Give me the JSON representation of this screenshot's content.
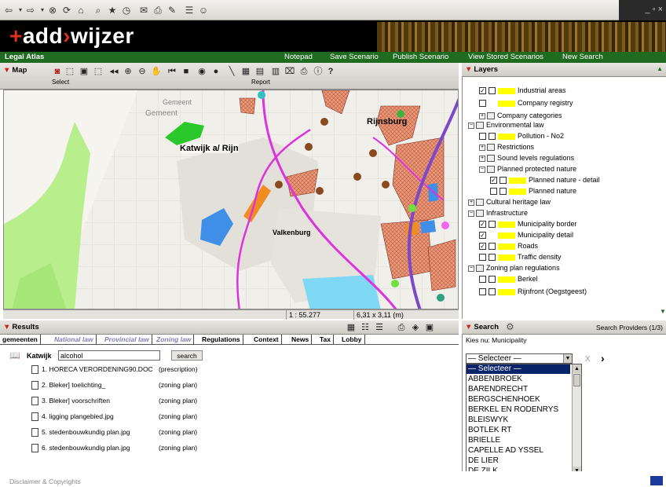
{
  "browser": {
    "toolbar_icons": [
      "back-icon",
      "forward-icon",
      "stop-icon",
      "refresh-icon",
      "home-icon",
      "search-icon",
      "favorites-icon",
      "history-icon",
      "mail-icon",
      "print-icon",
      "edit-icon",
      "discuss-icon",
      "messenger-icon"
    ],
    "window_controls": "_ ▫ ×"
  },
  "banner": {
    "logo_plus": "+",
    "logo_add": "add",
    "logo_arrow": "›",
    "logo_wijzer": "wijzer"
  },
  "greenbar": {
    "title": "Legal Atlas",
    "nav": [
      "Notepad",
      "Save Scenario",
      "Publish Scenario",
      "View Stored Scenarios",
      "New Search"
    ]
  },
  "map_panel": {
    "label": "Map",
    "select_label": "Select",
    "report_label": "Report",
    "help": "?",
    "scale": "1 : 55.277",
    "extent": "6,31 x 3,11 (m)",
    "places": {
      "katwijk": "Katwijk a/ Rijn",
      "rijnsburg": "Rijnsburg",
      "valkenburg": "Valkenburg",
      "gemeente": "Gemeent",
      "gemeente2": "Gemeent"
    }
  },
  "layers": {
    "label": "Layers",
    "rows": [
      {
        "label": "Industrial areas",
        "checked": true,
        "swatch": true
      },
      {
        "label": "Company registry",
        "checked": false,
        "swatch": true
      },
      {
        "label": "Company categories",
        "group": true
      },
      {
        "label": "Environmental law",
        "group": true
      },
      {
        "label": "Pollution - No2",
        "checked": false,
        "swatch": true
      },
      {
        "label": "Restrictions",
        "group": true
      },
      {
        "label": "Sound levels regulations",
        "group": true
      },
      {
        "label": "Planned protected nature",
        "group": true
      },
      {
        "label": "Planned nature - detail",
        "checked": true,
        "swatch": true
      },
      {
        "label": "Planned nature",
        "checked": false,
        "swatch": true
      },
      {
        "label": "Cultural heritage law",
        "group": true
      },
      {
        "label": "Infrastructure",
        "group": true
      },
      {
        "label": "Municipality border",
        "checked": true,
        "swatch": true
      },
      {
        "label": "Municipality detail",
        "checked": true,
        "swatch": false
      },
      {
        "label": "Roads",
        "checked": true,
        "swatch": true
      },
      {
        "label": "Traffic density",
        "checked": false,
        "swatch": false
      },
      {
        "label": "Zoning plan regulations",
        "group": true
      },
      {
        "label": "Berkel",
        "checked": false,
        "swatch": true
      },
      {
        "label": "Rijnfront (Oegstgeest)",
        "checked": false,
        "swatch": true
      }
    ]
  },
  "results": {
    "label": "Results",
    "tabs": [
      "gemeenten",
      "National law",
      "Provincial law",
      "Zoning law",
      "Regulations",
      "Context",
      "News",
      "Tax",
      "Lobby"
    ],
    "location": "Katwijk",
    "query": "alcohol",
    "search_button": "search",
    "items": [
      {
        "name": "1. HORECA VERORDENING90.DOC",
        "type": "(prescription)"
      },
      {
        "name": "2. Bleker] toelichting_",
        "type": "(zoning plan)"
      },
      {
        "name": "3. Bleker] voorschriften",
        "type": "(zoning plan)"
      },
      {
        "name": "4. ligging plangebied.jpg",
        "type": "(zoning plan)"
      },
      {
        "name": "5. stedenbouwkundig plan.jpg",
        "type": "(zoning plan)"
      },
      {
        "name": "6. stedenbouwkundig plan.jpg",
        "type": "(zoning plan)"
      }
    ]
  },
  "search": {
    "label": "Search",
    "providers": "Search Providers (1/3)",
    "kies": "Kies nu: Municipality",
    "select_value": "— Selecteer —",
    "clear": "X",
    "go": "›",
    "options": [
      "— Selecteer —",
      "ABBENBROEK",
      "BARENDRECHT",
      "BERGSCHENHOEK",
      "BERKEL EN RODENRYS",
      "BLEISWYK",
      "BOTLEK RT",
      "BRIELLE",
      "CAPELLE AD YSSEL",
      "DE LIER",
      "DE ZILK"
    ]
  },
  "footer": {
    "text": "Disclaimer & Copyrights"
  },
  "colors": {
    "green": "#1f6b20",
    "accent": "#e03020",
    "highlight": "#0a246a"
  }
}
